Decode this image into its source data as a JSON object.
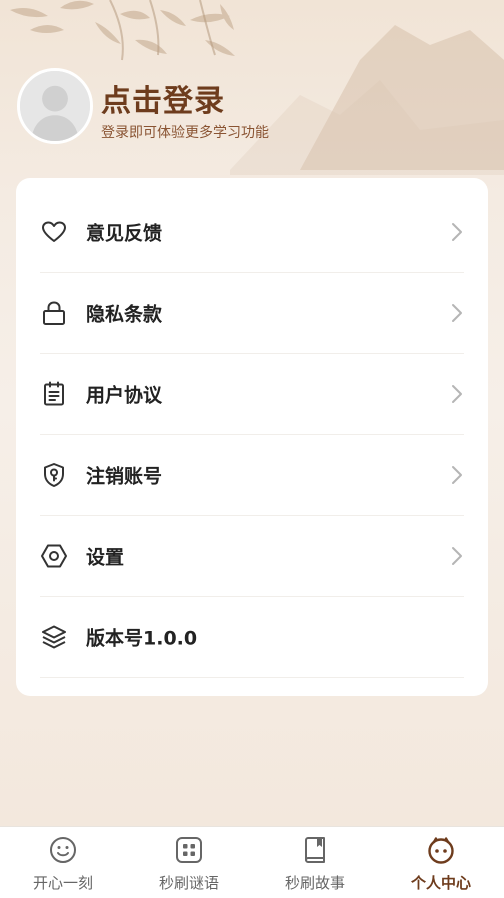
{
  "profile": {
    "login_title": "点击登录",
    "login_subtitle": "登录即可体验更多学习功能"
  },
  "menu": {
    "items": [
      {
        "label": "意见反馈",
        "icon": "heart-icon",
        "has_chevron": true
      },
      {
        "label": "隐私条款",
        "icon": "lock-icon",
        "has_chevron": true
      },
      {
        "label": "用户协议",
        "icon": "clipboard-icon",
        "has_chevron": true
      },
      {
        "label": "注销账号",
        "icon": "shield-key-icon",
        "has_chevron": true
      },
      {
        "label": "设置",
        "icon": "hexagon-nut-icon",
        "has_chevron": true
      },
      {
        "label": "版本号1.0.0",
        "icon": "layers-icon",
        "has_chevron": false
      }
    ]
  },
  "tabbar": {
    "active_index": 3,
    "tabs": [
      {
        "label": "开心一刻",
        "icon": "smile-icon"
      },
      {
        "label": "秒刷谜语",
        "icon": "grid-icon"
      },
      {
        "label": "秒刷故事",
        "icon": "book-icon"
      },
      {
        "label": "个人中心",
        "icon": "face-icon"
      }
    ]
  },
  "colors": {
    "accent": "#6e3c1d",
    "subtitle": "#8a5433",
    "icon_stroke": "#333333",
    "chevron": "#b5b5b5",
    "tab_inactive": "#666666"
  }
}
